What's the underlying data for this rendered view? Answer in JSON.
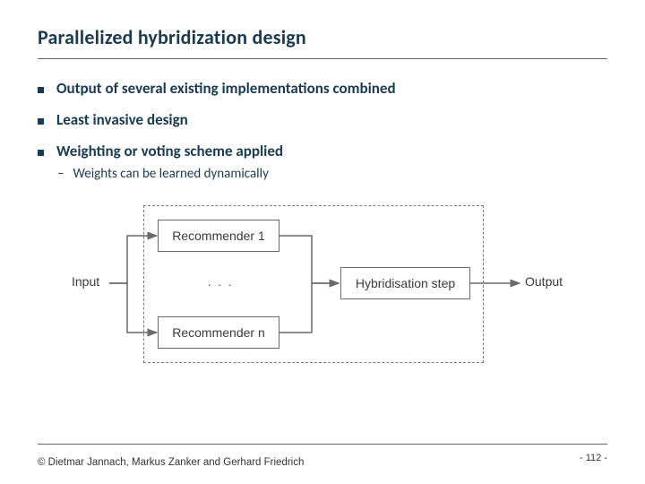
{
  "title": "Parallelized hybridization design",
  "bullets": [
    {
      "text": "Output of several existing implementations combined",
      "sub": []
    },
    {
      "text": "Least invasive design",
      "sub": []
    },
    {
      "text": "Weighting or voting scheme applied",
      "sub": [
        "Weights can be learned dynamically"
      ]
    }
  ],
  "diagram": {
    "input": "Input",
    "rec1": "Recommender 1",
    "ellipsis": ". . .",
    "recn": "Recommender n",
    "hybrid": "Hybridisation step",
    "output": "Output"
  },
  "copyright": "© Dietmar Jannach, Markus Zanker and Gerhard Friedrich",
  "page": "- 112 -"
}
